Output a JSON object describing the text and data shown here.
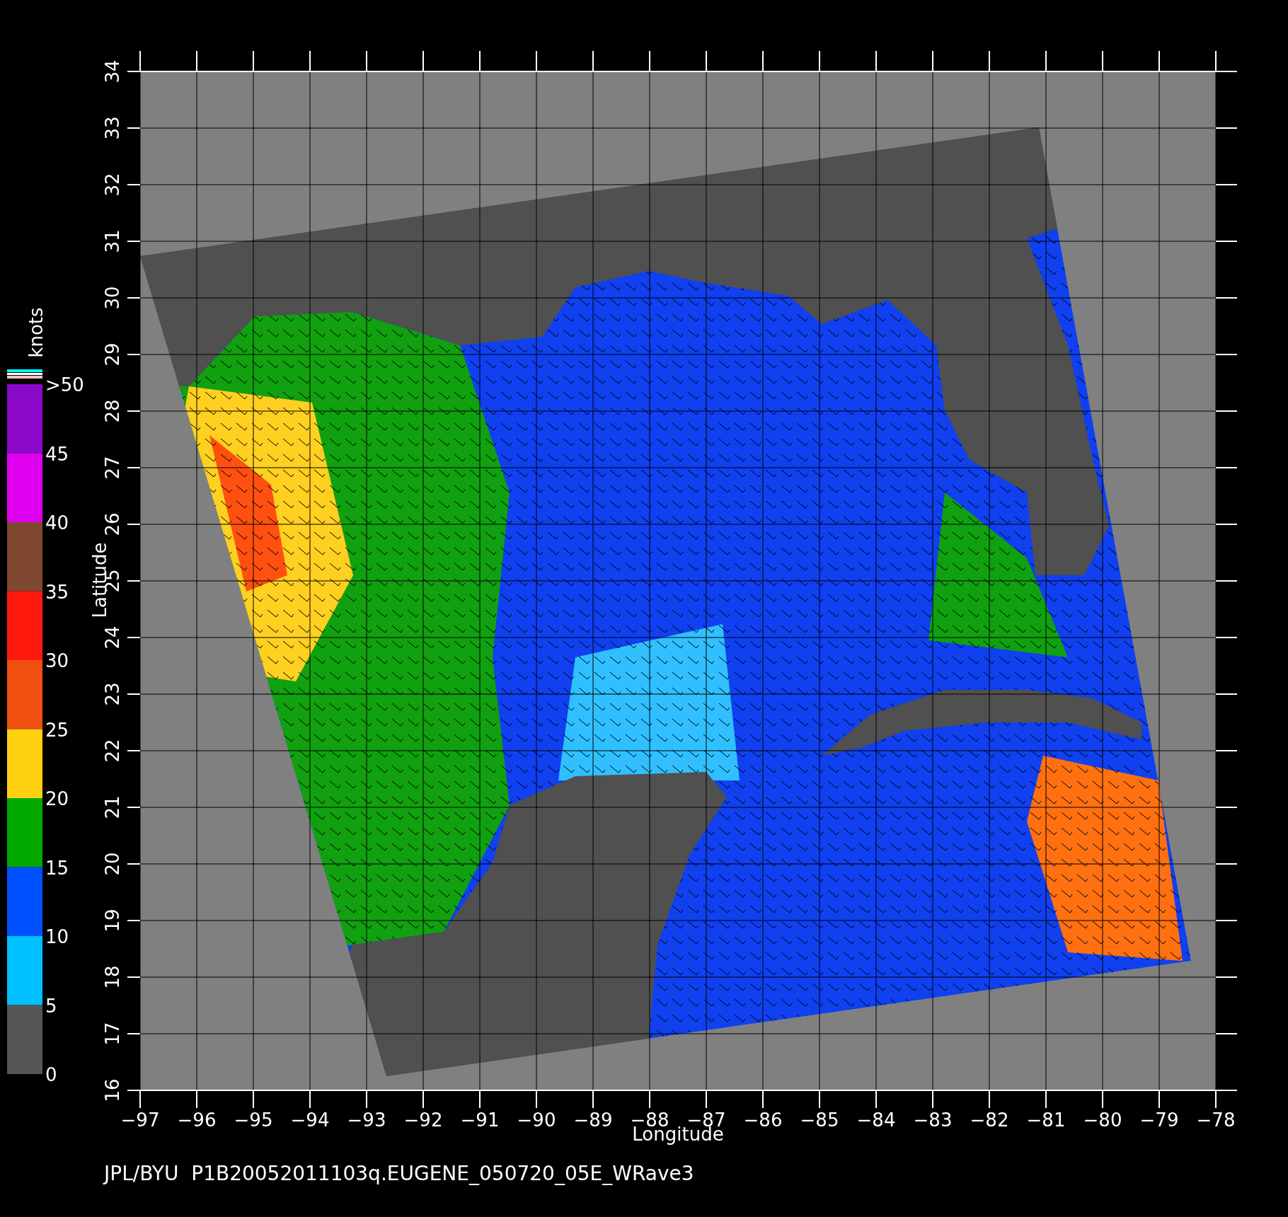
{
  "colorbar": {
    "unit": "knots",
    "top_label": ">50",
    "segments": [
      {
        "label": "45",
        "color": "#8a08c8"
      },
      {
        "label": "40",
        "color": "#e000f0"
      },
      {
        "label": "35",
        "color": "#804830"
      },
      {
        "label": "30",
        "color": "#ff1a10"
      },
      {
        "label": "25",
        "color": "#f05010"
      },
      {
        "label": "20",
        "color": "#ffd010"
      },
      {
        "label": "15",
        "color": "#00a800"
      },
      {
        "label": "10",
        "color": "#0050ff"
      },
      {
        "label": "5",
        "color": "#00c0ff"
      },
      {
        "label": "0",
        "color": "#555555"
      }
    ]
  },
  "map": {
    "xlabel": "Longitude",
    "ylabel": "Latitude",
    "xticks": [
      "−97",
      "−96",
      "−95",
      "−94",
      "−93",
      "−92",
      "−91",
      "−90",
      "−89",
      "−88",
      "−87",
      "−86",
      "−85",
      "−84",
      "−83",
      "−82",
      "−81",
      "−80",
      "−79",
      "−78"
    ],
    "yticks": [
      "16",
      "17",
      "18",
      "19",
      "20",
      "21",
      "22",
      "23",
      "24",
      "25",
      "26",
      "27",
      "28",
      "29",
      "30",
      "31",
      "32",
      "33",
      "34"
    ]
  },
  "caption": "JPL/BYU  P1B20052011103q.EUGENE_050720_05E_WRave3"
}
